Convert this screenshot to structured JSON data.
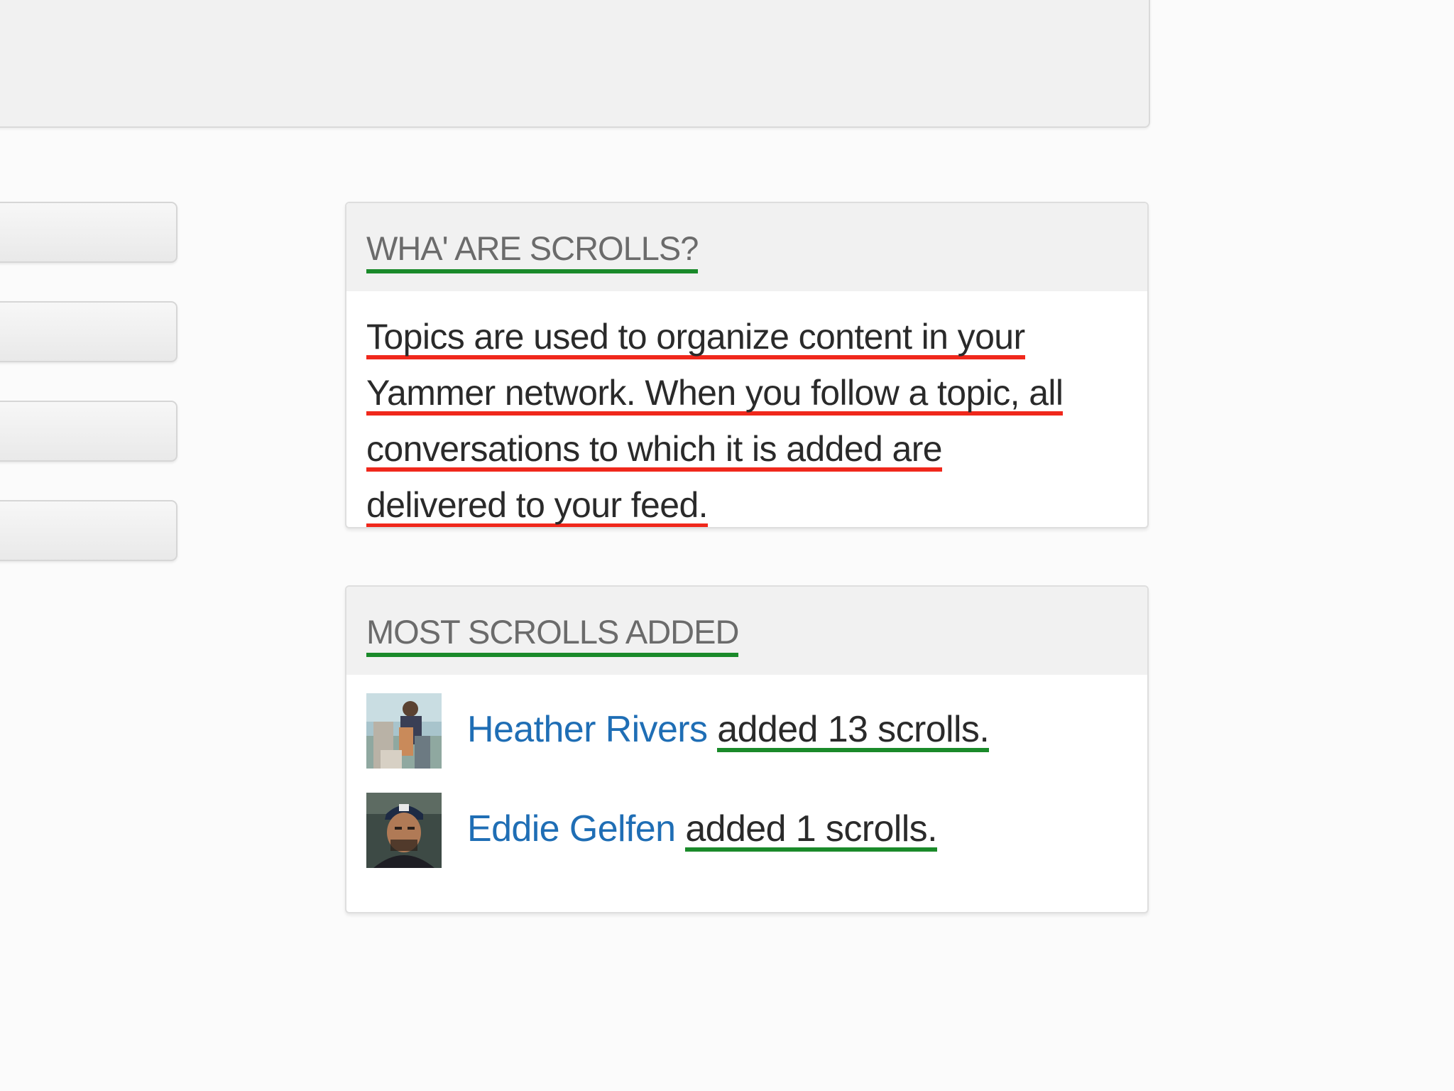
{
  "about_card": {
    "title": "WHA' ARE SCROLLS?",
    "description_lines": [
      "Topics are used to organize content in your",
      "Yammer network. When you follow a topic, all",
      "conversations to which it is added are",
      "delivered to your feed."
    ]
  },
  "top_contributors_card": {
    "title": "MOST SCROLLS ADDED",
    "contributors": [
      {
        "name": "Heather Rivers",
        "stat": "added 13 scrolls."
      },
      {
        "name": "Eddie Gelfen",
        "stat": "added 1 scrolls."
      }
    ]
  },
  "colors": {
    "link": "#1f6eb5",
    "title_underline": "#1a8a2a",
    "text_underline": "#f0281c",
    "header_bg": "#f1f1f1"
  }
}
